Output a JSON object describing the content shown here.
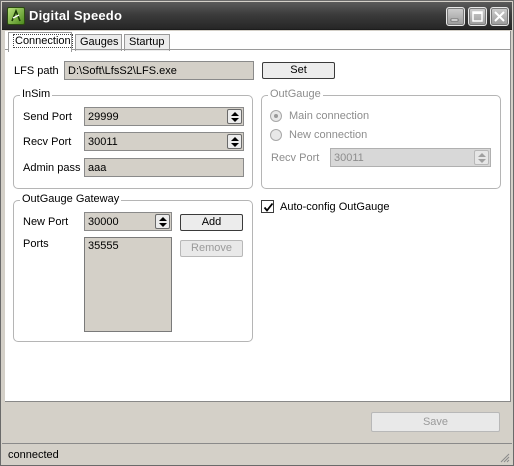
{
  "window": {
    "title": "Digital Speedo"
  },
  "tabs": [
    "Connection",
    "Gauges",
    "Startup"
  ],
  "lfs_path": {
    "label": "LFS path",
    "value": "D:\\Soft\\LfsS2\\LFS.exe",
    "set_label": "Set"
  },
  "insim": {
    "title": "InSim",
    "send_port_label": "Send Port",
    "send_port": "29999",
    "recv_port_label": "Recv Port",
    "recv_port": "30011",
    "admin_pass_label": "Admin pass",
    "admin_pass": "aaa"
  },
  "outgauge": {
    "title": "OutGauge",
    "main_connection": "Main connection",
    "new_connection": "New connection",
    "recv_port_label": "Recv Port",
    "recv_port": "30011"
  },
  "auto_config": {
    "label": "Auto-config OutGauge",
    "checked": true
  },
  "gateway": {
    "title": "OutGauge Gateway",
    "new_port_label": "New Port",
    "new_port": "30000",
    "add_label": "Add",
    "ports_label": "Ports",
    "ports": [
      "35555"
    ],
    "remove_label": "Remove"
  },
  "footer": {
    "save_label": "Save"
  },
  "status": {
    "text": "connected"
  },
  "icons": {
    "app": "speedo-app-icon",
    "minimize": "minimize-icon",
    "maximize": "maximize-icon",
    "close": "close-icon",
    "checkmark": "checkmark-icon",
    "grip": "resize-grip-icon"
  }
}
